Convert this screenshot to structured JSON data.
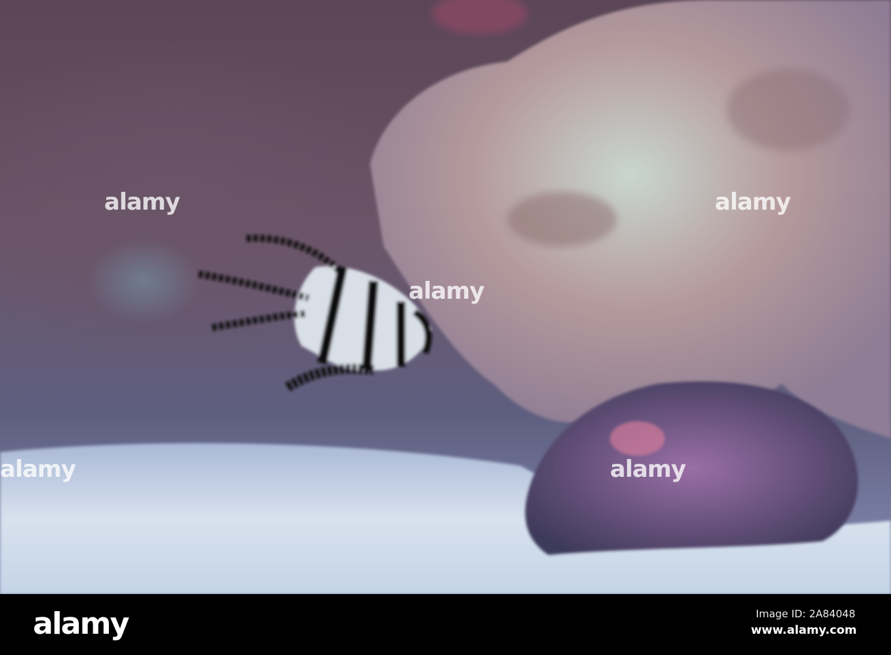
{
  "watermark": {
    "text": "alamy"
  },
  "footer": {
    "logo": "alamy",
    "image_id": "Image ID: 2A84048",
    "url": "www.alamy.com"
  }
}
